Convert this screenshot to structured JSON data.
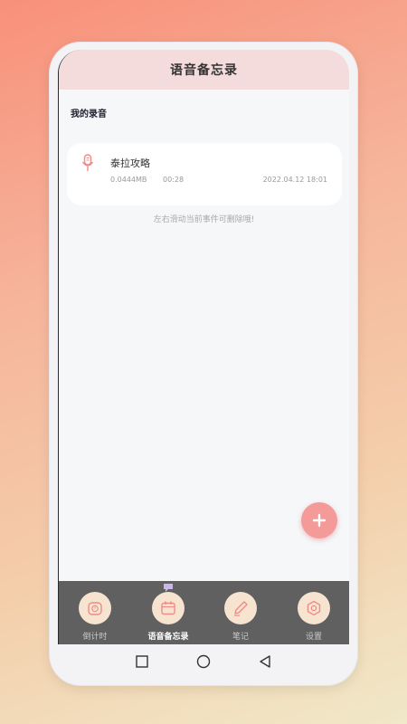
{
  "header": {
    "title": "语音备忘录"
  },
  "section": {
    "title": "我的录音"
  },
  "recordings": [
    {
      "title": "泰拉攻略",
      "size": "0.0444MB",
      "duration": "00:28",
      "date": "2022.04.12  18:01",
      "icon": "microphone-icon"
    }
  ],
  "hint": "左右滑动当前事件可删除哦!",
  "fab": {
    "icon": "plus-icon"
  },
  "tabs": [
    {
      "label": "倒计时",
      "icon": "clock-icon",
      "active": false
    },
    {
      "label": "语音备忘录",
      "icon": "calendar-icon",
      "active": true
    },
    {
      "label": "笔记",
      "icon": "pen-icon",
      "active": false
    },
    {
      "label": "设置",
      "icon": "gear-icon",
      "active": false
    }
  ],
  "navbar": {
    "buttons": [
      "recent-apps-icon",
      "home-icon",
      "back-icon"
    ]
  },
  "colors": {
    "header_bg": "#f3dcdb",
    "accent": "#f49a98",
    "tabbar_bg": "#606060",
    "tab_icon_bg": "#f6e4d1"
  }
}
